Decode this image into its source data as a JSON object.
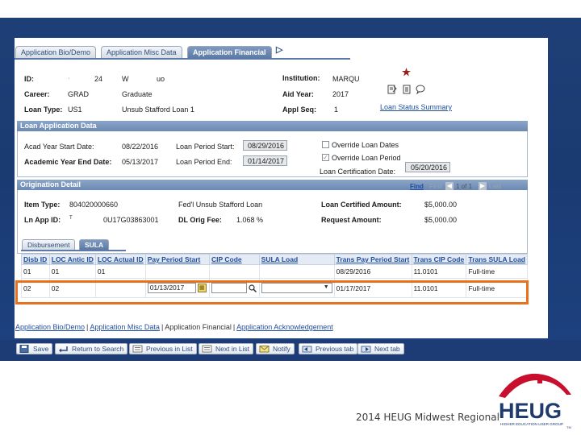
{
  "tabs": [
    "Application Bio/Demo",
    "Application Misc Data",
    "Application Financial"
  ],
  "header": {
    "id_label": "ID:",
    "id_value": "24",
    "name_part1": "W",
    "name_part2": "uo",
    "career_label": "Career:",
    "career_code": "GRAD",
    "career_desc": "Graduate",
    "loan_type_label": "Loan Type:",
    "loan_type_code": "US1",
    "loan_type_desc": "Unsub Stafford Loan 1",
    "institution_label": "Institution:",
    "institution_value": "MARQU",
    "aid_year_label": "Aid Year:",
    "aid_year_value": "2017",
    "appl_seq_label": "Appl Seq:",
    "appl_seq_value": "1",
    "loan_status_link": "Loan Status Summary"
  },
  "loan_app": {
    "title": "Loan Application Data",
    "acad_start_label": "Acad Year Start Date:",
    "acad_start_value": "08/22/2016",
    "acad_end_label": "Academic Year End Date:",
    "acad_end_value": "05/13/2017",
    "loan_start_label": "Loan Period Start:",
    "loan_start_value": "08/29/2016",
    "loan_end_label": "Loan Period End:",
    "loan_end_value": "01/14/2017",
    "override_dates_label": "Override Loan Dates",
    "override_period_label": "Override Loan Period",
    "cert_date_label": "Loan Certification Date:",
    "cert_date_value": "05/20/2016"
  },
  "origination": {
    "title": "Origination Detail",
    "find": "Find",
    "first": "First",
    "counter": "1 of 1",
    "last": "Last",
    "item_type_label": "Item Type:",
    "item_type_value": "804020000660",
    "item_type_desc": "Fed'l Unsub Stafford Loan",
    "ln_app_label": "Ln App ID:",
    "ln_app_value": "T",
    "ln_app_value2": "0U17G03863001",
    "dl_fee_label": "DL Orig Fee:",
    "dl_fee_value": "1.068",
    "dl_fee_unit": "%",
    "certified_label": "Loan Certified Amount:",
    "certified_value": "$5,000.00",
    "request_label": "Request Amount:",
    "request_value": "$5,000.00"
  },
  "subtabs": [
    "Disbursement",
    "SULA"
  ],
  "grid": {
    "headers": [
      "Disb ID",
      "LOC Antic ID",
      "LOC Actual ID",
      "Pay Period Start",
      "CIP Code",
      "SULA Load",
      "Trans Pay Period Start",
      "Trans CIP Code",
      "Trans SULA Load"
    ],
    "rows": [
      {
        "disb": "01",
        "antic": "01",
        "actual": "01",
        "pay": "",
        "cip": "",
        "load": "",
        "tpay": "08/29/2016",
        "tcip": "11.0101",
        "tload": "Full-time"
      },
      {
        "disb": "02",
        "antic": "02",
        "actual": "",
        "pay": "01/13/2017",
        "cip": "",
        "load": "",
        "tpay": "01/17/2017",
        "tcip": "11.0101",
        "tload": "Full-time"
      }
    ]
  },
  "toolbar": {
    "save": "Save",
    "return_search": "Return to Search",
    "prev_list": "Previous in List",
    "next_list": "Next in List",
    "notify": "Notify",
    "prev_tab": "Previous tab",
    "next_tab": "Next tab"
  },
  "bottom_links": [
    "Application Bio/Demo",
    "Application Misc Data",
    "Application Financial",
    "Application Acknowledgement"
  ],
  "footer": {
    "caption": "2014 HEUG Midwest Regional",
    "logo_text": "HEUG",
    "logo_sub": "HIGHER EDUCATION USER GROUP",
    "logo_tm": "TM"
  },
  "colors": {
    "highlight": "#e8711e",
    "header_blue": "#6c89b3",
    "link_blue": "#1f4ea1",
    "logo_red": "#c8102e",
    "logo_navy": "#1f3a6e"
  }
}
